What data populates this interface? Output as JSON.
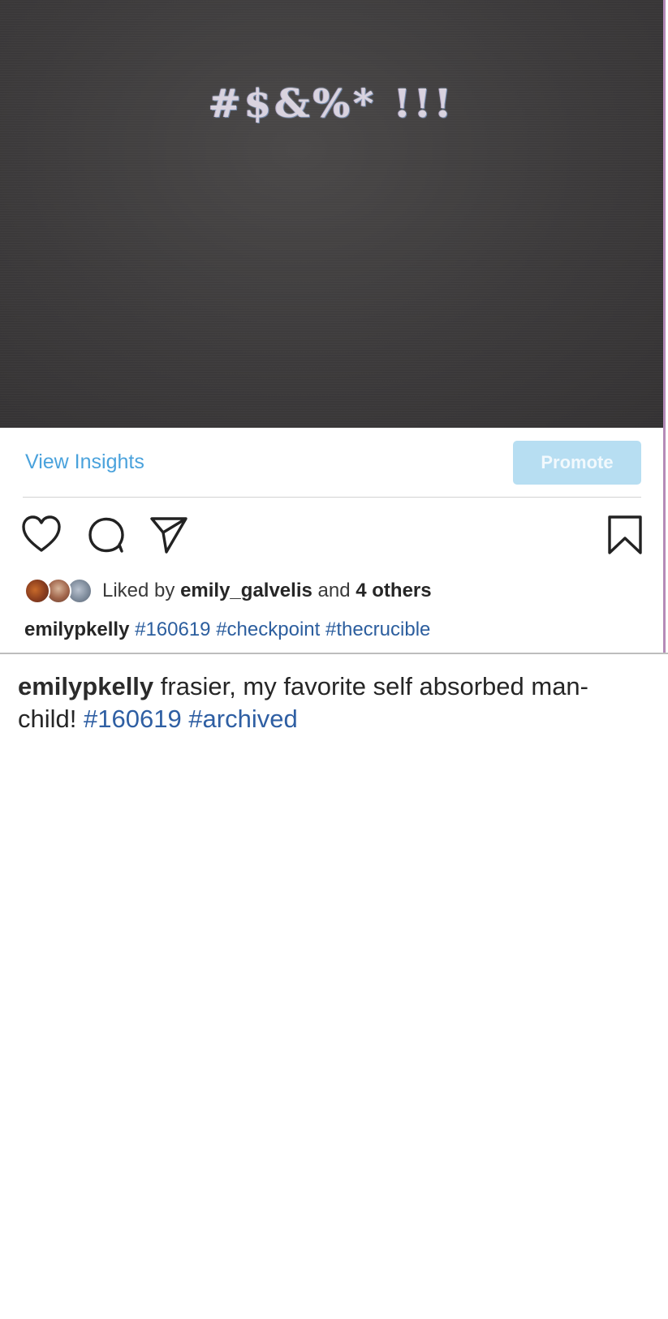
{
  "post": {
    "image_text": "#$&%* !!!",
    "insights_label": "View Insights",
    "promote_label": "Promote",
    "liked_by_prefix": "Liked by",
    "liked_by_user": "emily_galvelis",
    "liked_by_connector": "and",
    "liked_by_others": "4 others",
    "caption_username": "emilypkelly",
    "caption_hashtags": [
      "#160619",
      "#checkpoint",
      "#thecrucible"
    ]
  },
  "icons": {
    "like": "heart-icon",
    "comment": "comment-icon",
    "share": "send-icon",
    "save": "bookmark-icon"
  },
  "colors": {
    "link_blue": "#4aa2dc",
    "promote_bg": "#b7def2",
    "hashtag_blue": "#2c5e9e",
    "image_bg": "#3c3a3b"
  },
  "caption": {
    "username": "emilypkelly",
    "text": "frasier, my favorite self absorbed man-child!",
    "hashtags": [
      "#160619",
      "#archived"
    ]
  }
}
